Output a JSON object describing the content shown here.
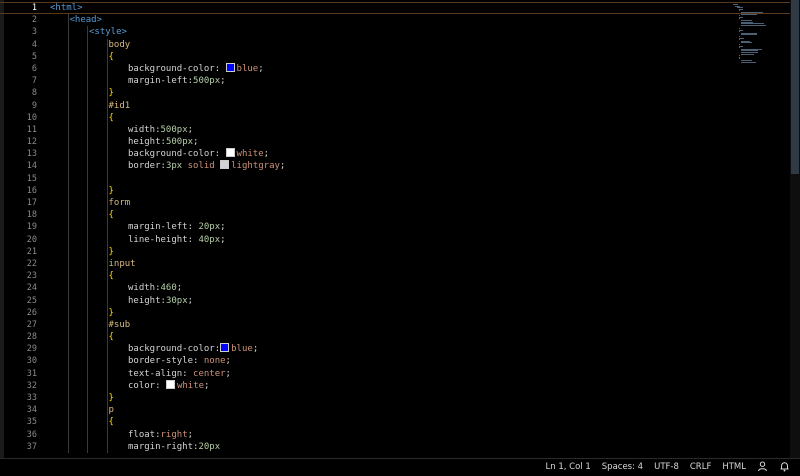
{
  "editor": {
    "current_line": 1,
    "lines": [
      {
        "n": "1",
        "indent": 0,
        "tokens": [
          {
            "t": "<html>",
            "c": "tag"
          }
        ]
      },
      {
        "n": "2",
        "indent": 1,
        "tokens": [
          {
            "t": "<head>",
            "c": "tag"
          }
        ]
      },
      {
        "n": "3",
        "indent": 2,
        "tokens": [
          {
            "t": "<style>",
            "c": "tag"
          }
        ]
      },
      {
        "n": "4",
        "indent": 3,
        "tokens": [
          {
            "t": "body",
            "c": "sel"
          }
        ]
      },
      {
        "n": "5",
        "indent": 3,
        "tokens": [
          {
            "t": "{",
            "c": "brace"
          }
        ]
      },
      {
        "n": "6",
        "indent": 4,
        "tokens": [
          {
            "t": "background-color: ",
            "c": "prop"
          },
          {
            "t": "",
            "c": "swatch",
            "color": "#0000ff"
          },
          {
            "t": "blue",
            "c": "val"
          },
          {
            "t": ";",
            "c": "punc"
          }
        ]
      },
      {
        "n": "7",
        "indent": 4,
        "tokens": [
          {
            "t": "margin-left:",
            "c": "prop"
          },
          {
            "t": "500px",
            "c": "num"
          },
          {
            "t": ";",
            "c": "punc"
          }
        ]
      },
      {
        "n": "8",
        "indent": 3,
        "tokens": [
          {
            "t": "}",
            "c": "brace"
          }
        ]
      },
      {
        "n": "9",
        "indent": 3,
        "tokens": [
          {
            "t": "#id1",
            "c": "sel"
          }
        ]
      },
      {
        "n": "10",
        "indent": 3,
        "tokens": [
          {
            "t": "{",
            "c": "brace"
          }
        ]
      },
      {
        "n": "11",
        "indent": 4,
        "tokens": [
          {
            "t": "width:",
            "c": "prop"
          },
          {
            "t": "500px",
            "c": "num"
          },
          {
            "t": ";",
            "c": "punc"
          }
        ]
      },
      {
        "n": "12",
        "indent": 4,
        "tokens": [
          {
            "t": "height:",
            "c": "prop"
          },
          {
            "t": "500px",
            "c": "num"
          },
          {
            "t": ";",
            "c": "punc"
          }
        ]
      },
      {
        "n": "13",
        "indent": 4,
        "tokens": [
          {
            "t": "background-color: ",
            "c": "prop"
          },
          {
            "t": "",
            "c": "swatch",
            "color": "#ffffff"
          },
          {
            "t": "white",
            "c": "val"
          },
          {
            "t": ";",
            "c": "punc"
          }
        ]
      },
      {
        "n": "14",
        "indent": 4,
        "tokens": [
          {
            "t": "border:",
            "c": "prop"
          },
          {
            "t": "3px",
            "c": "num"
          },
          {
            "t": " solid ",
            "c": "val"
          },
          {
            "t": "",
            "c": "swatch",
            "color": "#d3d3d3"
          },
          {
            "t": "lightgray",
            "c": "val"
          },
          {
            "t": ";",
            "c": "punc"
          }
        ]
      },
      {
        "n": "15",
        "indent": 4,
        "tokens": []
      },
      {
        "n": "16",
        "indent": 3,
        "tokens": [
          {
            "t": "}",
            "c": "brace"
          }
        ]
      },
      {
        "n": "17",
        "indent": 3,
        "tokens": [
          {
            "t": "form",
            "c": "sel"
          }
        ]
      },
      {
        "n": "18",
        "indent": 3,
        "tokens": [
          {
            "t": "{",
            "c": "brace"
          }
        ]
      },
      {
        "n": "19",
        "indent": 4,
        "tokens": [
          {
            "t": "margin-left: ",
            "c": "prop"
          },
          {
            "t": "20px",
            "c": "num"
          },
          {
            "t": ";",
            "c": "punc"
          }
        ]
      },
      {
        "n": "20",
        "indent": 4,
        "tokens": [
          {
            "t": "line-height: ",
            "c": "prop"
          },
          {
            "t": "40px",
            "c": "num"
          },
          {
            "t": ";",
            "c": "punc"
          }
        ]
      },
      {
        "n": "21",
        "indent": 3,
        "tokens": [
          {
            "t": "}",
            "c": "brace"
          }
        ]
      },
      {
        "n": "22",
        "indent": 3,
        "tokens": [
          {
            "t": "input",
            "c": "sel"
          }
        ]
      },
      {
        "n": "23",
        "indent": 3,
        "tokens": [
          {
            "t": "{",
            "c": "brace"
          }
        ]
      },
      {
        "n": "24",
        "indent": 4,
        "tokens": [
          {
            "t": "width:",
            "c": "prop"
          },
          {
            "t": "460",
            "c": "num"
          },
          {
            "t": ";",
            "c": "punc"
          }
        ]
      },
      {
        "n": "25",
        "indent": 4,
        "tokens": [
          {
            "t": "height:",
            "c": "prop"
          },
          {
            "t": "30px",
            "c": "num"
          },
          {
            "t": ";",
            "c": "punc"
          }
        ]
      },
      {
        "n": "26",
        "indent": 3,
        "tokens": [
          {
            "t": "}",
            "c": "brace"
          }
        ]
      },
      {
        "n": "27",
        "indent": 3,
        "tokens": [
          {
            "t": "#sub",
            "c": "sel"
          }
        ]
      },
      {
        "n": "28",
        "indent": 3,
        "tokens": [
          {
            "t": "{",
            "c": "brace"
          }
        ]
      },
      {
        "n": "29",
        "indent": 4,
        "tokens": [
          {
            "t": "background-color:",
            "c": "prop"
          },
          {
            "t": "",
            "c": "swatch",
            "color": "#0000ff"
          },
          {
            "t": "blue",
            "c": "val"
          },
          {
            "t": ";",
            "c": "punc"
          }
        ]
      },
      {
        "n": "30",
        "indent": 4,
        "tokens": [
          {
            "t": "border-style: ",
            "c": "prop"
          },
          {
            "t": "none",
            "c": "val"
          },
          {
            "t": ";",
            "c": "punc"
          }
        ]
      },
      {
        "n": "31",
        "indent": 4,
        "tokens": [
          {
            "t": "text-align: ",
            "c": "prop"
          },
          {
            "t": "center",
            "c": "val"
          },
          {
            "t": ";",
            "c": "punc"
          }
        ]
      },
      {
        "n": "32",
        "indent": 4,
        "tokens": [
          {
            "t": "color: ",
            "c": "prop"
          },
          {
            "t": "",
            "c": "swatch",
            "color": "#ffffff"
          },
          {
            "t": "white",
            "c": "val"
          },
          {
            "t": ";",
            "c": "punc"
          }
        ]
      },
      {
        "n": "33",
        "indent": 3,
        "tokens": [
          {
            "t": "}",
            "c": "brace"
          }
        ]
      },
      {
        "n": "34",
        "indent": 3,
        "tokens": [
          {
            "t": "p",
            "c": "sel"
          }
        ]
      },
      {
        "n": "35",
        "indent": 3,
        "tokens": [
          {
            "t": "{",
            "c": "brace"
          }
        ]
      },
      {
        "n": "36",
        "indent": 4,
        "tokens": [
          {
            "t": "float:",
            "c": "prop"
          },
          {
            "t": "right",
            "c": "val"
          },
          {
            "t": ";",
            "c": "punc"
          }
        ]
      },
      {
        "n": "37",
        "indent": 4,
        "tokens": [
          {
            "t": "margin-right:",
            "c": "prop"
          },
          {
            "t": "20px",
            "c": "num"
          }
        ]
      }
    ]
  },
  "colors": {
    "tag": "#569cd6",
    "sel": "#d7ba7d",
    "brace": "#ffd700",
    "prop": "#d4d4d4",
    "val": "#ce9178",
    "num": "#b5cea8",
    "punc": "#d4d4d4"
  },
  "statusbar": {
    "position": "Ln 1, Col 1",
    "spaces": "Spaces: 4",
    "encoding": "UTF-8",
    "eol": "CRLF",
    "language": "HTML",
    "feedback_icon": "feedback-person-icon",
    "bell_icon": "notification-bell-icon"
  }
}
